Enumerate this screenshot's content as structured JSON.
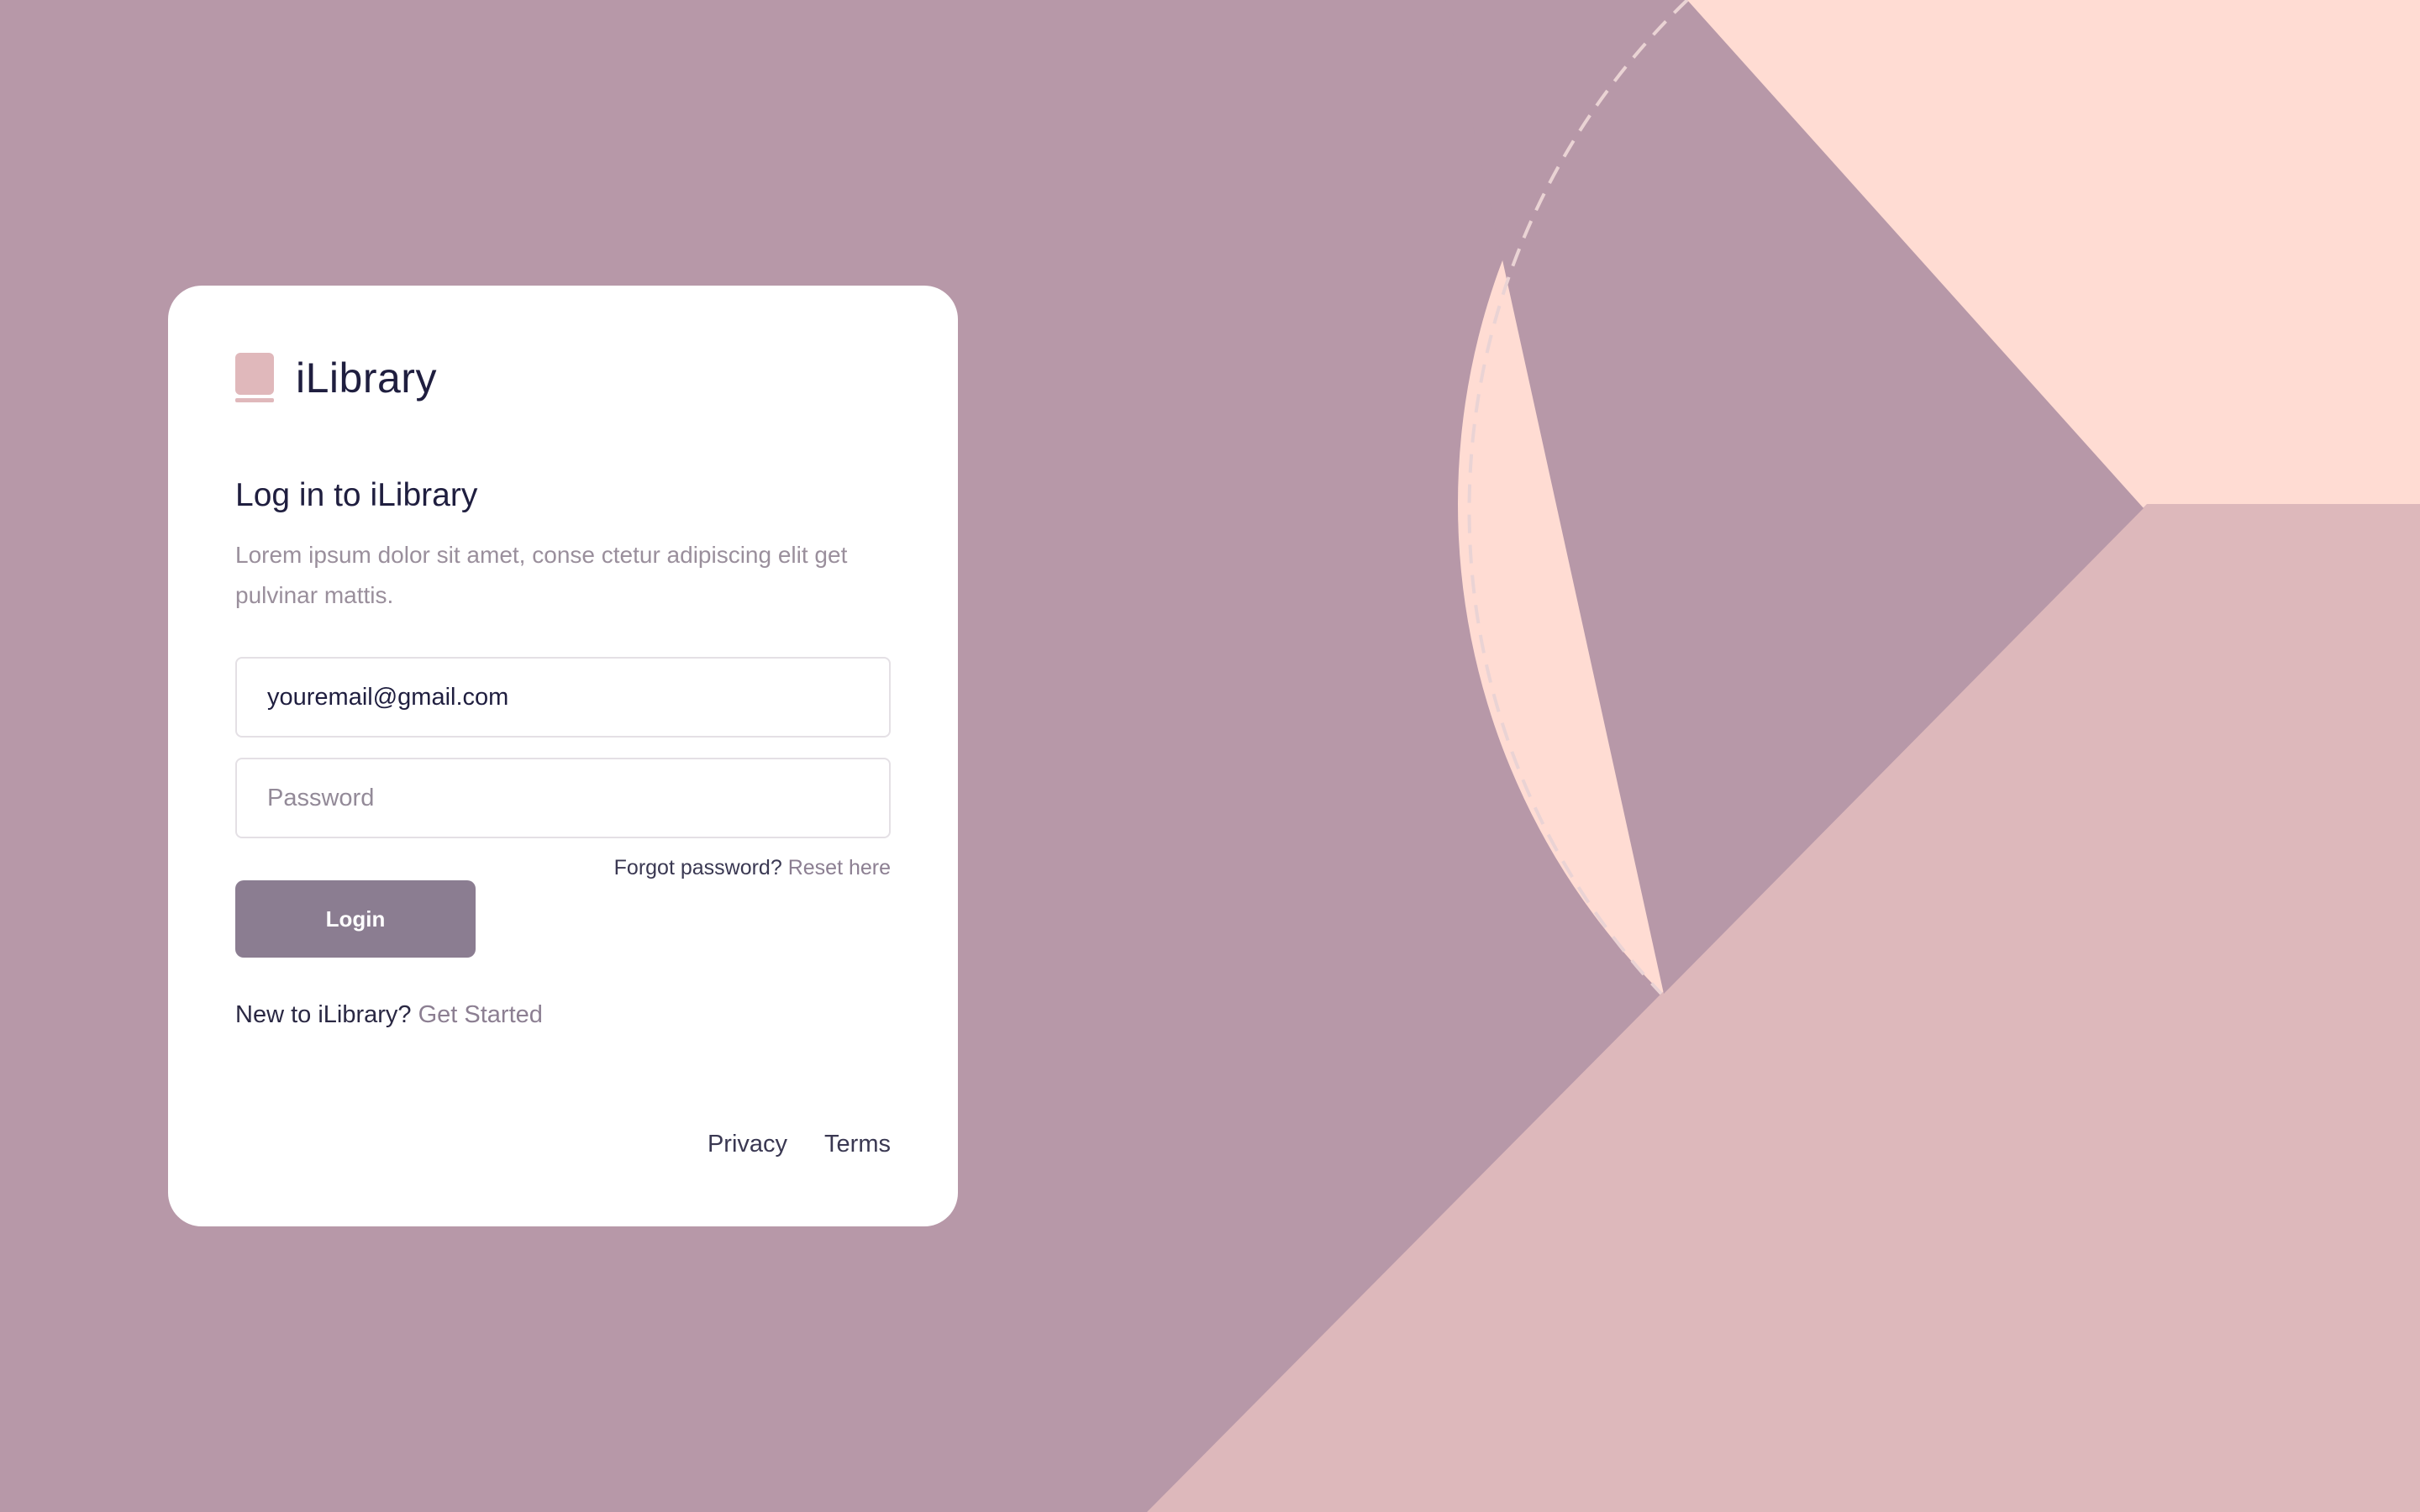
{
  "app": {
    "name": "iLibrary",
    "logo_icon": "book-icon"
  },
  "login": {
    "heading": "Log in to iLibrary",
    "subtitle": "Lorem ipsum dolor sit amet, conse ctetur adipiscing elit get pulvinar mattis.",
    "email_value": "youremail@gmail.com",
    "password_placeholder": "Password",
    "forgot_text": "Forgot password?",
    "reset_link": "Reset here",
    "login_button": "Login",
    "signup_text": "New to iLibrary?",
    "signup_link": "Get Started"
  },
  "footer": {
    "privacy": "Privacy",
    "terms": "Terms"
  },
  "colors": {
    "background_mauve": "#b798a8",
    "peach": "#ffdcd3",
    "pink": "#ddb8bb",
    "button": "#8b7d91",
    "text_dark": "#1f1e3f",
    "text_muted": "#9a8f9c"
  }
}
